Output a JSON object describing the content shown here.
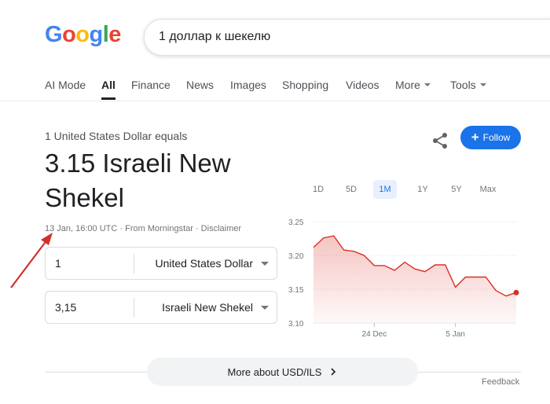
{
  "logo": {
    "letters": [
      {
        "ch": "G",
        "color": "#4285F4"
      },
      {
        "ch": "o",
        "color": "#EA4335"
      },
      {
        "ch": "o",
        "color": "#FBBC05"
      },
      {
        "ch": "g",
        "color": "#4285F4"
      },
      {
        "ch": "l",
        "color": "#34A853"
      },
      {
        "ch": "e",
        "color": "#EA4335"
      }
    ]
  },
  "search": {
    "query": "1 доллар к шекелю"
  },
  "tabs": [
    {
      "label": "AI Mode"
    },
    {
      "label": "All",
      "active": true
    },
    {
      "label": "Finance"
    },
    {
      "label": "News"
    },
    {
      "label": "Images"
    },
    {
      "label": "Shopping"
    },
    {
      "label": "Videos"
    },
    {
      "label": "More",
      "dropdown": true
    },
    {
      "label": "Tools",
      "dropdown": true
    }
  ],
  "converter": {
    "equals_label": "1 United States Dollar equals",
    "result": "3.15 Israeli New Shekel",
    "meta": "13 Jan, 16:00 UTC · From Morningstar · Disclaimer",
    "from": {
      "value": "1",
      "currency": "United States Dollar"
    },
    "to": {
      "value": "3,15",
      "currency": "Israeli New Shekel"
    },
    "follow_label": "Follow"
  },
  "ranges": [
    {
      "label": "1D"
    },
    {
      "label": "5D"
    },
    {
      "label": "1M",
      "active": true
    },
    {
      "label": "1Y"
    },
    {
      "label": "5Y"
    },
    {
      "label": "Max"
    }
  ],
  "chart_data": {
    "type": "area",
    "ylim": [
      3.1,
      3.25
    ],
    "yticks": [
      "3.25",
      "3.20",
      "3.15",
      "3.10"
    ],
    "xticks": [
      {
        "label": "24 Dec",
        "index": 6
      },
      {
        "label": "5 Jan",
        "index": 14
      }
    ],
    "values": [
      3.212,
      3.226,
      3.229,
      3.208,
      3.206,
      3.2,
      3.185,
      3.185,
      3.178,
      3.19,
      3.18,
      3.176,
      3.186,
      3.186,
      3.153,
      3.168,
      3.168,
      3.168,
      3.148,
      3.14,
      3.145
    ],
    "line_color": "#d93025",
    "fill_color": "#fce8e6"
  },
  "more_button": {
    "label": "More about USD/ILS"
  },
  "feedback": "Feedback"
}
